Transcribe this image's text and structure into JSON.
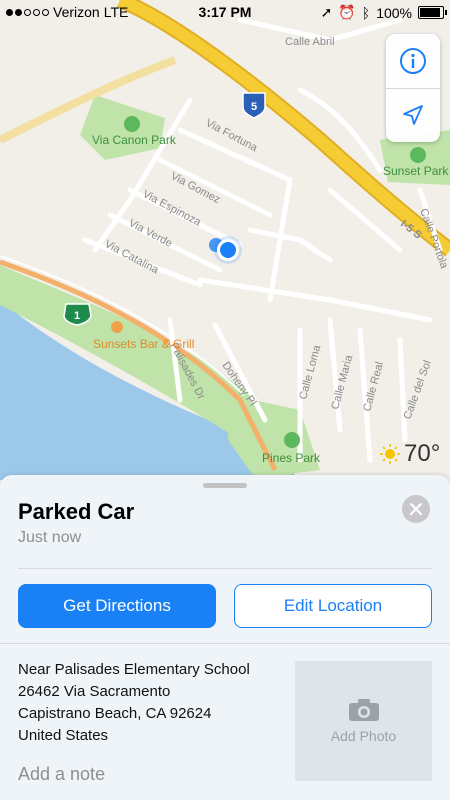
{
  "status_bar": {
    "carrier": "Verizon",
    "network": "LTE",
    "time": "3:17 PM",
    "battery": "100%",
    "signal_bars": 2,
    "battery_level": 1.0
  },
  "map": {
    "streets": [
      "Calle Abril",
      "Via Fortuna",
      "Via Gomez",
      "Via Espinoza",
      "Via Verde",
      "Via Catalina",
      "Palisades Dr",
      "Doheny Pl",
      "Calle Loma",
      "Calle Maria",
      "Calle Real",
      "Calle del Sol",
      "Calle Portola",
      "I-5 S"
    ],
    "pois": [
      "Via Canon Park",
      "Sunset Park",
      "Sunsets Bar & Grill",
      "Pines Park"
    ],
    "shields": {
      "interstate": "5",
      "state_route": "1"
    },
    "colors": {
      "land": "#f2efe9",
      "park": "#bfe3a8",
      "water": "#9cc9ea",
      "freeway": "#f5cc33",
      "user_location": "#1a80f5"
    }
  },
  "map_controls": {
    "info_icon": "info-icon",
    "tracking_icon": "location-arrow-icon"
  },
  "weather": {
    "temp": "70°",
    "icon": "sun-icon"
  },
  "card": {
    "title": "Parked Car",
    "subtitle": "Just now",
    "get_directions": "Get Directions",
    "edit_location": "Edit Location",
    "address_lines": [
      "Near Palisades Elementary School",
      "26462 Via Sacramento",
      "Capistrano Beach, CA  92624",
      "United States"
    ],
    "note_placeholder": "Add a note",
    "add_photo": "Add Photo",
    "accent": "#1a80f5"
  }
}
